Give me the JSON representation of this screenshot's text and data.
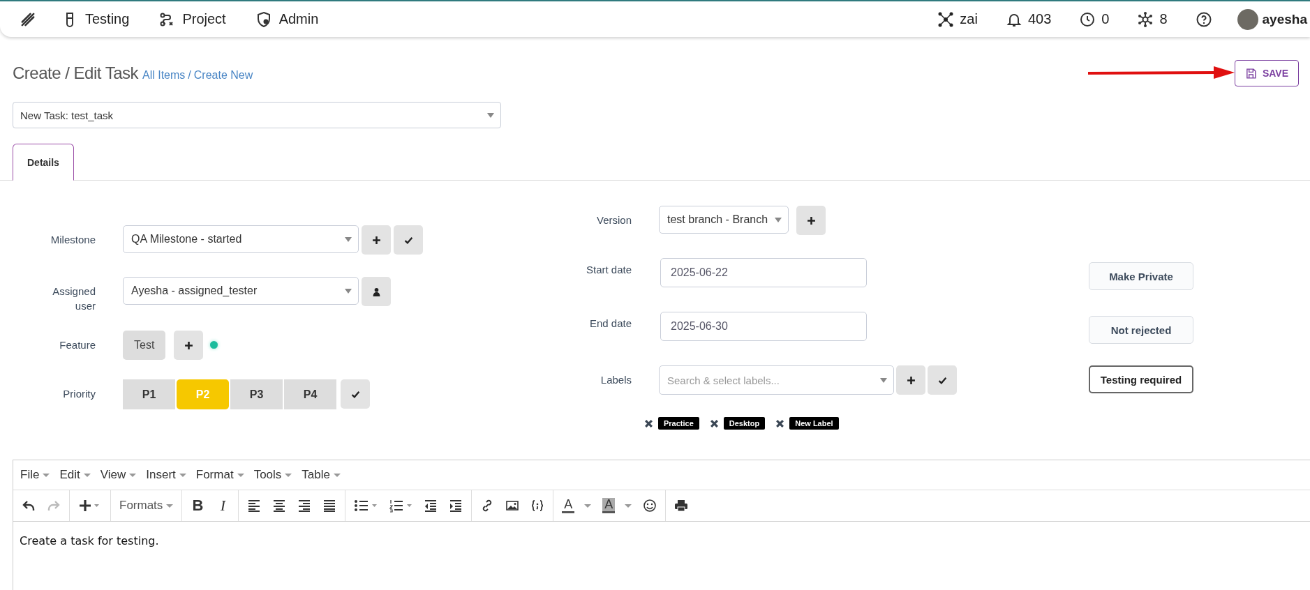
{
  "nav": {
    "items": [
      {
        "kind": "flask",
        "label": "Testing"
      },
      {
        "kind": "flow",
        "label": "Project"
      },
      {
        "kind": "shield",
        "label": "Admin"
      }
    ],
    "status": [
      {
        "kind": "ai",
        "text": "zai"
      },
      {
        "kind": "bell",
        "text": "403"
      },
      {
        "kind": "clock",
        "text": "0"
      },
      {
        "kind": "network",
        "text": "8"
      },
      {
        "kind": "help"
      }
    ],
    "user": "ayesha"
  },
  "header": {
    "title": "Create / Edit Task",
    "breadcrumbs": [
      "All Items",
      "Create New"
    ],
    "separator": "/",
    "save": "SAVE"
  },
  "task_select": {
    "value": "New Task: test_task"
  },
  "tabs": [
    {
      "label": "Details",
      "selected": true
    }
  ],
  "left_fields": [
    {
      "kind": "select_add_check",
      "label": "Milestone",
      "value": "QA Milestone - started"
    },
    {
      "kind": "select_user",
      "label": "Assigned user",
      "value": "Ayesha - assigned_tester"
    },
    {
      "kind": "feature",
      "label": "Feature",
      "tag": "Test"
    },
    {
      "kind": "priority",
      "label": "Priority",
      "options": [
        {
          "label": "P1",
          "selected": false
        },
        {
          "label": "P2",
          "selected": true
        },
        {
          "label": "P3",
          "selected": false
        },
        {
          "label": "P4",
          "selected": false
        }
      ]
    }
  ],
  "right_fields": [
    {
      "kind": "select_add",
      "label": "Version",
      "value": "test branch - Branch"
    },
    {
      "kind": "date",
      "label": "Start date",
      "value": "2025-06-22",
      "toggle": {
        "label": "Make Private",
        "on": false
      }
    },
    {
      "kind": "date",
      "label": "End date",
      "value": "2025-06-30",
      "toggle": {
        "label": "Not rejected",
        "on": false
      }
    },
    {
      "kind": "labels",
      "label": "Labels",
      "placeholder": "Search & select labels...",
      "toggle": {
        "label": "Testing required",
        "on": true
      }
    }
  ],
  "selected_labels": [
    "Practice",
    "Desktop",
    "New Label"
  ],
  "editor": {
    "menu": [
      "File",
      "Edit",
      "View",
      "Insert",
      "Format",
      "Tools",
      "Table"
    ],
    "formats": "Formats",
    "bold": "B",
    "italic": "I",
    "text_color": "A",
    "background_color": "A",
    "content": "Create a task for testing."
  }
}
